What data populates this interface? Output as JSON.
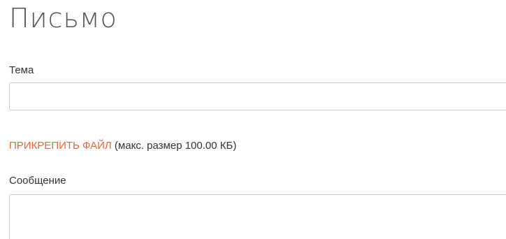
{
  "form": {
    "title": "Письмо",
    "subject": {
      "label": "Тема",
      "value": "",
      "placeholder": ""
    },
    "attachment": {
      "link_text": "ПРИКРЕПИТЬ ФАЙЛ",
      "hint": " (макс. размер 100.00 КБ)"
    },
    "message": {
      "label": "Сообщение",
      "value": "",
      "placeholder": ""
    }
  },
  "colors": {
    "accent": "#e8673c",
    "text": "#333333",
    "title": "#555555",
    "border": "#c9c9c9"
  }
}
